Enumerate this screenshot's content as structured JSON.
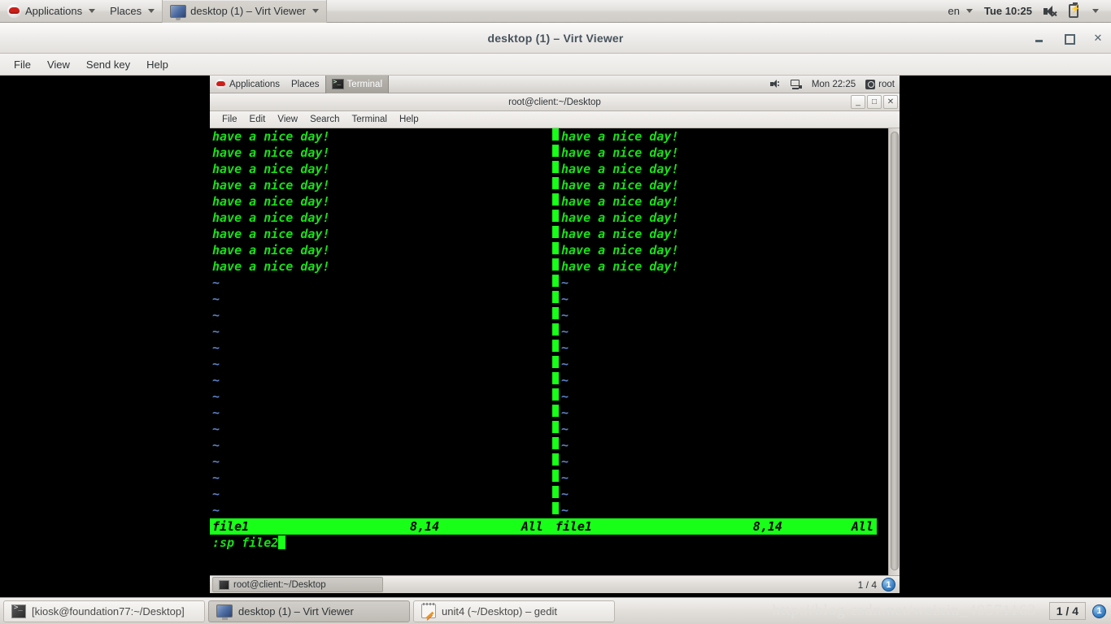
{
  "host_panel": {
    "applications_label": "Applications",
    "places_label": "Places",
    "window_button_label": "desktop (1) – Virt Viewer",
    "keyboard_layout": "en",
    "clock": "Tue 10:25",
    "icons": {
      "menu": "redhat-icon",
      "window": "monitor-icon",
      "volume": "volume-muted-icon",
      "battery": "battery-charging-icon"
    }
  },
  "virt_viewer": {
    "title": "desktop (1) – Virt Viewer",
    "menu": [
      "File",
      "View",
      "Send key",
      "Help"
    ],
    "window_controls": {
      "minimize": "–",
      "maximize": "□",
      "close": "✕"
    }
  },
  "guest_panel": {
    "applications_label": "Applications",
    "places_label": "Places",
    "window_button_label": "Terminal",
    "clock": "Mon 22:25",
    "user": "root"
  },
  "terminal": {
    "title": "root@client:~/Desktop",
    "menu": [
      "File",
      "Edit",
      "View",
      "Search",
      "Terminal",
      "Help"
    ],
    "window_controls": {
      "minimize": "_",
      "maximize": "□",
      "close": "✕"
    }
  },
  "vim": {
    "text_line": "have a nice day!",
    "text_line_count": 9,
    "tilde": "~",
    "tilde_count_left": 15,
    "tilde_count_right": 15,
    "panes": [
      {
        "file": "file1",
        "position": "8,14",
        "percent": "All"
      },
      {
        "file": "file1",
        "position": "8,14",
        "percent": "All"
      }
    ],
    "command_line": ":sp file2",
    "colors": {
      "text": "#18e018",
      "background": "#000000",
      "status_bg": "#18ff18",
      "status_fg": "#000000",
      "tilde": "#5a7fc0"
    }
  },
  "guest_taskbar": {
    "window_button_label": "root@client:~/Desktop",
    "pager_label": "1 / 4",
    "workspace_number": "1"
  },
  "host_taskbar": {
    "buttons": [
      {
        "label": "[kiosk@foundation77:~/Desktop]",
        "icon": "terminal-icon",
        "active": false
      },
      {
        "label": "desktop (1) – Virt Viewer",
        "icon": "monitor-icon",
        "active": true
      },
      {
        "label": "unit4 (~/Desktop) – gedit",
        "icon": "gedit-icon",
        "active": false
      }
    ],
    "pager_label": "1 / 4",
    "workspace_number": "1",
    "watermark": "http://blog.csdn.net/weixin_40571163"
  }
}
